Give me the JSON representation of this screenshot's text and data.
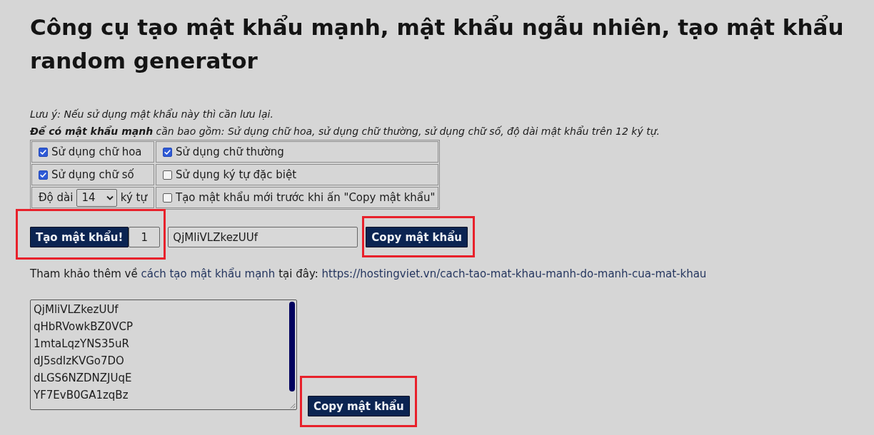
{
  "title": "Công cụ tạo mật khẩu mạnh, mật khẩu ngẫu nhiên, tạo mật khẩu random generator",
  "notes": [
    "Lưu ý: Nếu sử dụng mật khẩu này thì cần lưu lại.",
    "**Để có mật khẩu mạnh** cần bao gồm: Sử dụng chữ hoa, sử dụng chữ thường, sử dụng chữ số, độ dài mật khẩu trên 12 ký tự."
  ],
  "options": [
    {
      "kind": "checkbox",
      "label": "Sử dụng chữ hoa",
      "checked": true
    },
    {
      "kind": "checkbox",
      "label": "Sử dụng chữ thường",
      "checked": true
    },
    {
      "kind": "checkbox",
      "label": "Sử dụng chữ số",
      "checked": true
    },
    {
      "kind": "checkbox",
      "label": "Sử dụng ký tự đặc biệt",
      "checked": false
    },
    {
      "kind": "length",
      "label": "Độ dài",
      "value": "14",
      "unit": "ký tự"
    },
    {
      "kind": "checkbox",
      "label": "Tạo mật khẩu mới trước khi ấn \"Copy mật khẩu\"",
      "checked": false
    }
  ],
  "generator": {
    "create": {
      "button": "Tạo mật khẩu!",
      "count": "1",
      "highlighted": true
    },
    "password": "QjMliVLZkezUUf",
    "copy": {
      "button": "Copy mật khẩu",
      "highlighted": true
    }
  },
  "reference": [
    {
      "kind": "text",
      "text": "Tham khảo thêm về"
    },
    {
      "kind": "link",
      "text": "cách tạo mật khẩu mạnh"
    },
    {
      "kind": "text",
      "text": "tại đây:"
    },
    {
      "kind": "link",
      "text": "https://hostingviet.vn/cach-tao-mat-khau-manh-do-manh-cua-mat-khau"
    }
  ],
  "history": {
    "passwords": [
      "QjMliVLZkezUUf",
      "qHbRVowkBZ0VCP",
      "1mtaLqzYNS35uR",
      "dJ5sdIzKVGo7DO",
      "dLGS6NZDNZJUqE",
      "YF7EvB0GA1zqBz"
    ],
    "copy": {
      "button": "Copy mật khẩu",
      "highlighted": true
    }
  }
}
